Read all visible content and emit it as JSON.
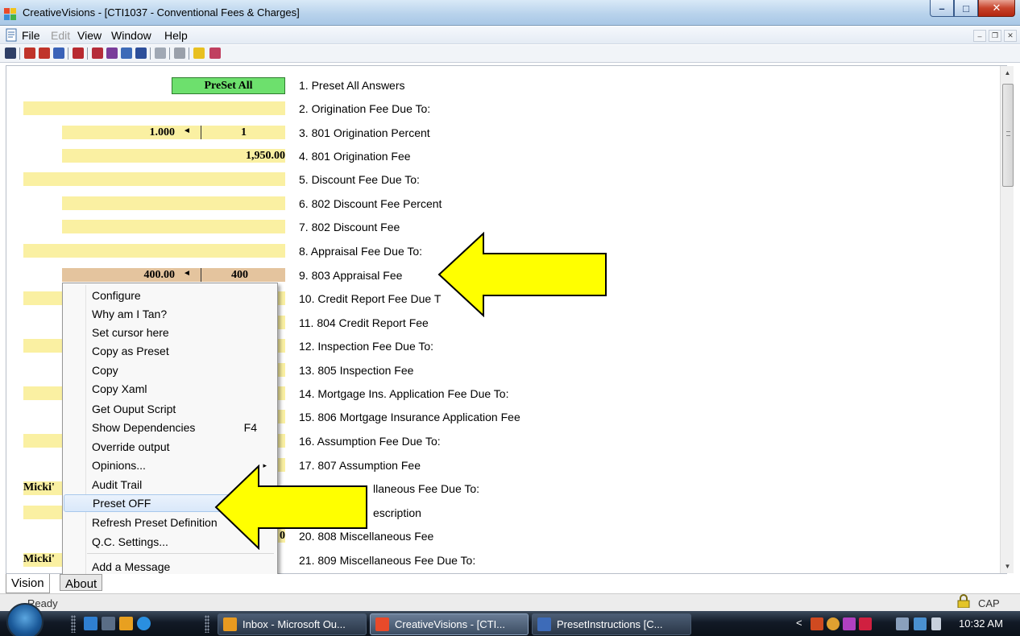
{
  "window": {
    "title": "CreativeVisions - [CTI1037 - Conventional Fees & Charges]",
    "min_glyph": "–",
    "max_glyph": "□",
    "close_glyph": "✕"
  },
  "menubar": {
    "items": [
      "File",
      "Edit",
      "View",
      "Window",
      "Help"
    ],
    "mdi_min": "–",
    "mdi_restore": "❐",
    "mdi_close": "✕"
  },
  "preset_button": "PreSet All",
  "fields": {
    "origination_percent_left": "1.000",
    "origination_percent_right": "1",
    "origination_fee": "1,950.00",
    "appraisal_fee_left": "400.00",
    "appraisal_fee_right": "400",
    "partial_digit": "0",
    "micki_1": "Micki'",
    "micki_2": "Micki'",
    "spin_arrow": "◄"
  },
  "questions": [
    "1. Preset All Answers",
    "2. Origination Fee Due To:",
    "3. 801 Origination Percent",
    "4. 801 Origination Fee",
    "5. Discount Fee Due To:",
    "6. 802 Discount Fee Percent",
    "7. 802 Discount Fee",
    "8. Appraisal Fee Due To:",
    "9. 803 Appraisal Fee",
    "10.  Credit Report Fee Due T",
    "11. 804 Credit Report Fee",
    "12. Inspection Fee Due To:",
    "13. 805 Inspection Fee",
    "14. Mortgage Ins. Application Fee Due To:",
    "15. 806 Mortgage Insurance Application Fee",
    "16. Assumption Fee Due To:",
    "17. 807 Assumption Fee",
    "llaneous Fee Due To:",
    "escription",
    "20. 808 Miscellaneous Fee",
    "21. 809 Miscellaneous Fee Due To:"
  ],
  "context_menu": {
    "items": [
      "Configure",
      "Why am I Tan?",
      "Set cursor here",
      "Copy as Preset",
      "Copy",
      "Copy Xaml",
      "Get Ouput Script",
      "Show Dependencies",
      "Override output",
      "Opinions...",
      "Audit Trail",
      "Preset OFF",
      "Refresh Preset Definition",
      "Q.C. Settings...",
      "Add a Message"
    ],
    "show_dependencies_shortcut": "F4",
    "submenu_glyph": "▸",
    "highlighted": "Preset OFF"
  },
  "scrollbar": {
    "up_glyph": "▲",
    "down_glyph": "▼"
  },
  "tabs": [
    "Vision",
    "About"
  ],
  "status": {
    "text": "Ready",
    "cap": "CAP"
  },
  "taskbar": {
    "tasks": [
      "Inbox - Microsoft Ou...",
      "CreativeVisions - [CTI...",
      "PresetInstructions [C..."
    ],
    "active_task": "CreativeVisions - [CTI...",
    "tray_chevron": "<",
    "clock": "10:32 AM"
  },
  "colors": {
    "field_yellow": "#faf0a2",
    "field_tan": "#e4c49e",
    "preset_green": "#6de06d",
    "annotation_arrow": "#ffff00"
  }
}
